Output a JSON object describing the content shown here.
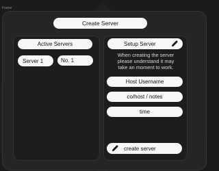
{
  "frame": {
    "label": "Frame"
  },
  "header": {
    "create_server_label": "Create Server"
  },
  "active_servers": {
    "title": "Active Servers",
    "items": [
      {
        "label": "Server 1"
      },
      {
        "label": "No. 1"
      }
    ]
  },
  "setup_server": {
    "title": "Setup Server",
    "title_icon": "pencil-icon",
    "description_lines": [
      "When creating the server",
      "please understand it may",
      "take an moment to work."
    ],
    "fields": [
      {
        "label": "Host Username"
      },
      {
        "label": "co/host / notes"
      },
      {
        "label": "time"
      }
    ],
    "submit_label": "create server",
    "submit_icon": "pencil-icon"
  },
  "colors": {
    "background": "#1b1b1b",
    "frame": "#252525",
    "panel": "#1d1d1d",
    "pill": "#f7f7f7",
    "text_dark": "#111111",
    "text_light": "#d8d8d8"
  }
}
